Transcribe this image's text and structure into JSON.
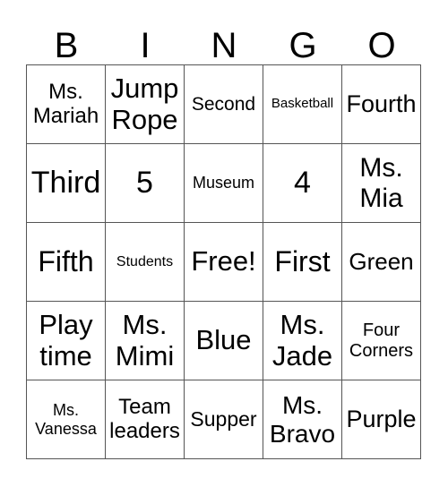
{
  "header": [
    "B",
    "I",
    "N",
    "G",
    "O"
  ],
  "cells": [
    [
      "Ms.\nMariah",
      "Jump\nRope",
      "Second",
      "Basketball",
      "Fourth"
    ],
    [
      "Third",
      "5",
      "Museum",
      "4",
      "Ms.\nMia"
    ],
    [
      "Fifth",
      "Students",
      "Free!",
      "First",
      "Green"
    ],
    [
      "Play\ntime",
      "Ms.\nMimi",
      "Blue",
      "Ms.\nJade",
      "Four\nCorners"
    ],
    [
      "Ms.\nVanessa",
      "Team\nleaders",
      "Supper",
      "Ms.\nBravo",
      "Purple"
    ]
  ]
}
